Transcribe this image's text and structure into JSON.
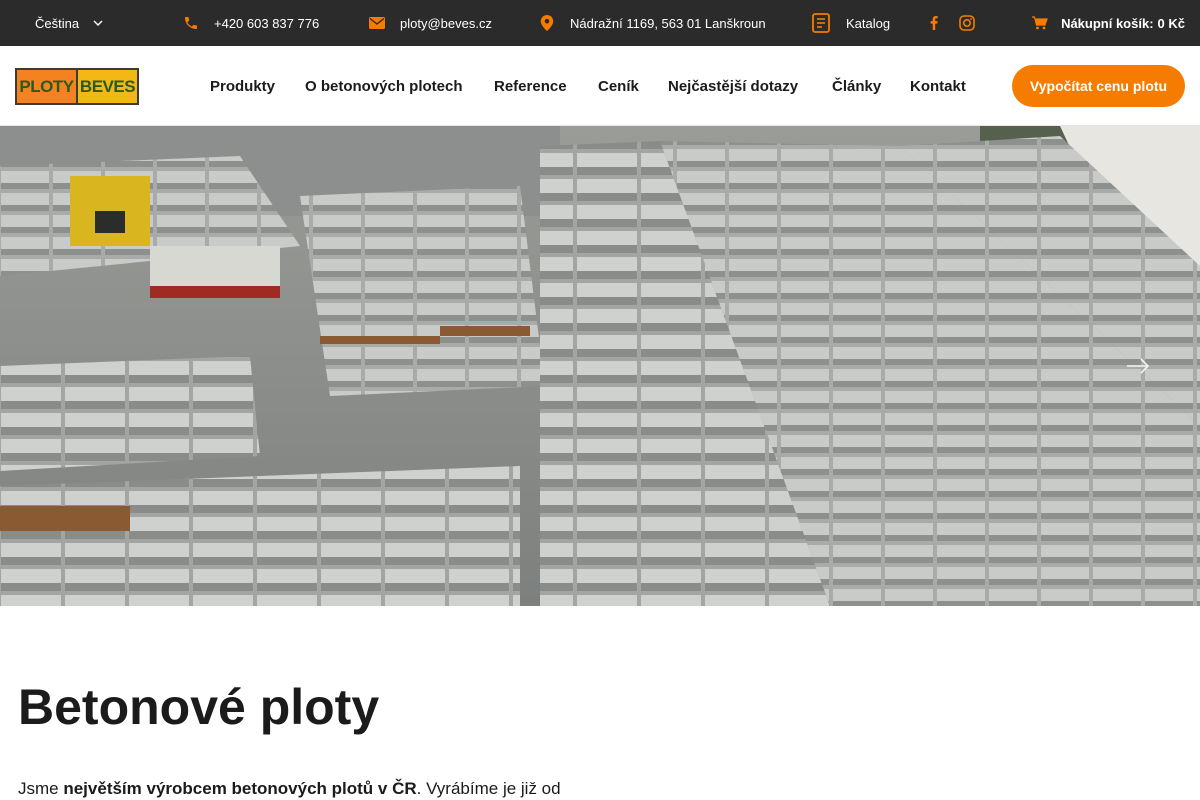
{
  "topbar": {
    "language": "Čeština",
    "phone": "+420 603 837 776",
    "email": "ploty@beves.cz",
    "address": "Nádražní 1169, 563 01 Lanškroun",
    "catalog": "Katalog",
    "cart_label": "Nákupní košík:",
    "cart_value": "0 Kč"
  },
  "logo": {
    "part1": "PLOTY",
    "part2": "BEVES"
  },
  "nav": {
    "items": [
      {
        "label": "Produkty"
      },
      {
        "label": "O betonových plotech"
      },
      {
        "label": "Reference"
      },
      {
        "label": "Ceník"
      },
      {
        "label": "Nejčastější dotazy"
      },
      {
        "label": "Články"
      },
      {
        "label": "Kontakt"
      }
    ],
    "cta": "Vypočítat cenu plotu"
  },
  "main": {
    "title": "Betonové ploty",
    "intro_start": "Jsme ",
    "intro_bold": "největším výrobcem betonových plotů v ČR",
    "intro_end": ". Vyrábíme je již od"
  },
  "icons": {
    "phone": "phone-icon",
    "email": "mail-icon",
    "address": "map-pin-icon",
    "catalog": "document-icon",
    "facebook": "facebook-icon",
    "instagram": "instagram-icon",
    "cart": "cart-icon",
    "language_dropdown": "chevron-down-icon",
    "slider_next": "arrow-right-icon"
  },
  "colors": {
    "accent": "#f57c00",
    "topbar_bg": "#2b2b2b",
    "text": "#1b1b1b"
  }
}
